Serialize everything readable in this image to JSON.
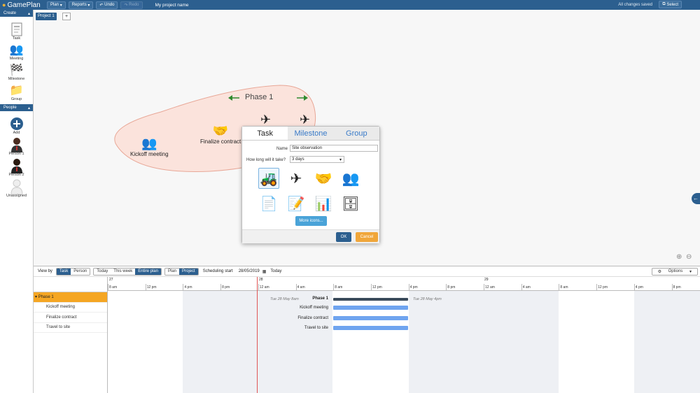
{
  "app": {
    "name": "GamePlan",
    "project_name": "My project name",
    "save_status": "All changes saved",
    "select_label": "Select"
  },
  "menus": [
    {
      "label": "Plan"
    },
    {
      "label": "Reports"
    }
  ],
  "undo_label": "Undo",
  "redo_label": "Redo",
  "project_tab": "Project 1",
  "add_tab": "+",
  "sidebar": {
    "create_header": "Create",
    "create_items": [
      {
        "label": "Task",
        "icon": "task-icon"
      },
      {
        "label": "Meeting",
        "icon": "meeting-icon"
      },
      {
        "label": "Milestone",
        "icon": "milestone-flag-icon"
      },
      {
        "label": "Group",
        "icon": "folder-icon"
      }
    ],
    "people_header": "People",
    "people_items": [
      {
        "label": "Add",
        "icon": "add-icon"
      },
      {
        "label": "Person 1",
        "icon": "person-icon"
      },
      {
        "label": "Person 2",
        "icon": "person-icon"
      },
      {
        "label": "Unassigned",
        "icon": "person-outline-icon"
      }
    ]
  },
  "canvas": {
    "phase_label": "Phase 1",
    "nodes": [
      {
        "label": "Kickoff meeting",
        "icon": "meeting-icon"
      },
      {
        "label": "Finalize contract",
        "icon": "handshake-icon"
      },
      {
        "label": "",
        "icon": "airplane-icon"
      },
      {
        "label": "",
        "icon": "airplane-icon"
      }
    ]
  },
  "dialog": {
    "tabs": [
      "Task",
      "Milestone",
      "Group"
    ],
    "name_label": "Name",
    "name_value": "Site observation",
    "duration_label": "How long will it take?",
    "duration_value": "3 days",
    "icons": [
      "excavator-icon",
      "airplane-icon",
      "handshake-icon",
      "meeting-icon",
      "task-document-icon",
      "report-icon",
      "presentation-icon",
      "servers-icon"
    ],
    "more_icons": "More icons...",
    "ok": "OK",
    "cancel": "Cancel"
  },
  "gantt_toolbar": {
    "view_by": "View by",
    "view_options": [
      "Task",
      "Person"
    ],
    "range_options": [
      "Today",
      "This week",
      "Entire plan"
    ],
    "mode_options": [
      "Plan",
      "Project"
    ],
    "scheduling_label": "Scheduling start",
    "scheduling_date": "28/05/2019",
    "today_label": "Today",
    "options_label": "Options"
  },
  "gantt": {
    "rows": [
      {
        "label": "Phase 1",
        "group": true
      },
      {
        "label": "Kickoff meeting"
      },
      {
        "label": "Finalize contract"
      },
      {
        "label": "Travel to site"
      }
    ],
    "day_labels": [
      "27",
      "28",
      "",
      "29"
    ],
    "ticks": [
      "8 am",
      "12 pm",
      "4 pm",
      "8 pm",
      "12 am",
      "4 am",
      "8 am",
      "12 pm",
      "4 pm",
      "8 pm",
      "12 am",
      "4 am",
      "8 am",
      "12 pm",
      "4 pm",
      "8 pm"
    ],
    "start_note": "Tue 28 May 8am",
    "end_note": "Tue 28 May 4pm",
    "accent": "#2c5f8f",
    "bar_color": "#6fa4ef",
    "summary_color": "#3a4a5a",
    "today_line_color": "#e05555"
  }
}
